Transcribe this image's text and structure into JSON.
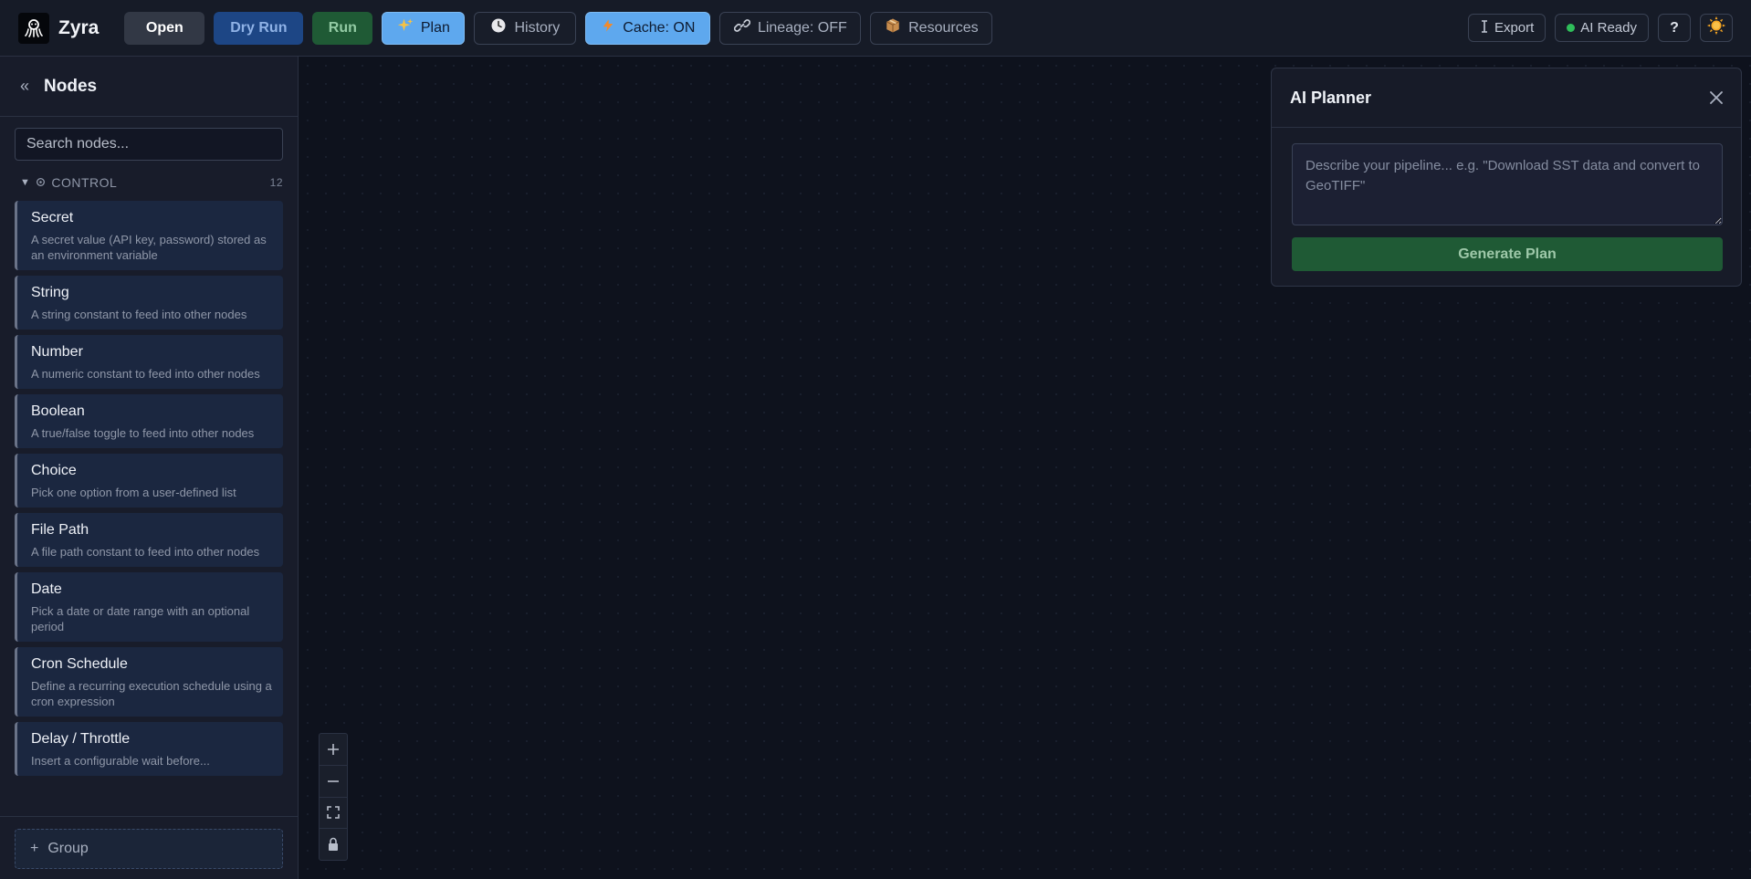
{
  "app": {
    "name": "Zyra"
  },
  "toolbar": {
    "open_label": "Open",
    "dry_run_label": "Dry Run",
    "run_label": "Run",
    "plan_label": "Plan",
    "history_label": "History",
    "cache_label": "Cache: ON",
    "lineage_label": "Lineage: OFF",
    "resources_label": "Resources",
    "export_label": "Export",
    "ai_status_label": "AI Ready",
    "help_label": "?"
  },
  "sidebar": {
    "title": "Nodes",
    "search_placeholder": "Search nodes...",
    "category": {
      "name": "CONTROL",
      "count": "12"
    },
    "nodes": [
      {
        "name": "Secret",
        "desc": "A secret value (API key, password) stored as an environment variable"
      },
      {
        "name": "String",
        "desc": "A string constant to feed into other nodes"
      },
      {
        "name": "Number",
        "desc": "A numeric constant to feed into other nodes"
      },
      {
        "name": "Boolean",
        "desc": "A true/false toggle to feed into other nodes"
      },
      {
        "name": "Choice",
        "desc": "Pick one option from a user-defined list"
      },
      {
        "name": "File Path",
        "desc": "A file path constant to feed into other nodes"
      },
      {
        "name": "Date",
        "desc": "Pick a date or date range with an optional period"
      },
      {
        "name": "Cron Schedule",
        "desc": "Define a recurring execution schedule using a cron expression"
      },
      {
        "name": "Delay / Throttle",
        "desc": "Insert a configurable wait before..."
      }
    ],
    "group_label": "Group"
  },
  "planner": {
    "title": "AI Planner",
    "textarea_placeholder": "Describe your pipeline... e.g. \"Download SST data and convert to GeoTIFF\"",
    "generate_label": "Generate Plan"
  },
  "icons": {
    "plan": "sparkles-icon",
    "history": "clock-icon",
    "cache": "lightning-icon",
    "lineage": "link-icon",
    "resources": "package-icon",
    "export": "export-icon",
    "theme": "sun-icon"
  },
  "colors": {
    "accent_blue": "#5ea8ee",
    "run_green": "#1f5a35",
    "dry_run_blue": "#1d4685",
    "status_green": "#2fbe5a"
  }
}
